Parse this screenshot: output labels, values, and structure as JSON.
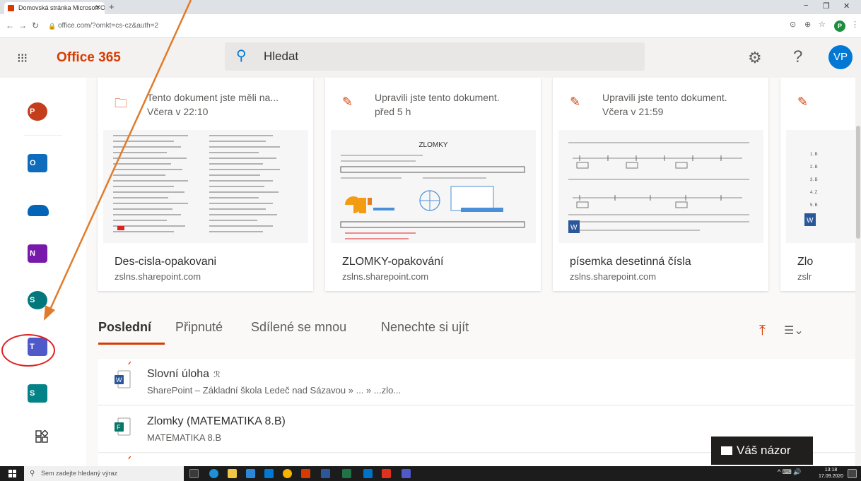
{
  "browser": {
    "tab_title": "Domovská stránka Microsoft Offi",
    "url": "office.com/?omkt=cs-cz&auth=2",
    "profile_initial": "P"
  },
  "header": {
    "brand": "Office 365",
    "search_placeholder": "Hledat",
    "avatar_initials": "VP",
    "help_label": "?"
  },
  "colors": {
    "brand": "#d83b01",
    "accent": "#0078d4",
    "annotation": "#e07b2a",
    "annotation_circle": "#e02020"
  },
  "rail": {
    "apps": [
      {
        "name": "PowerPoint",
        "letter": "P",
        "color": "#c43e1c"
      },
      {
        "name": "Outlook",
        "letter": "O",
        "color": "#0f6cbd"
      },
      {
        "name": "OneDrive",
        "letter": "",
        "color": "#0364b8"
      },
      {
        "name": "OneNote",
        "letter": "N",
        "color": "#7719aa"
      },
      {
        "name": "SharePoint",
        "letter": "S",
        "color": "#03787c"
      },
      {
        "name": "Teams",
        "letter": "T",
        "color": "#5059c9"
      },
      {
        "name": "Sway",
        "letter": "S",
        "color": "#038387"
      }
    ]
  },
  "cards": [
    {
      "action1": "Tento dokument jste měli na...",
      "action2": "Včera v 22:10",
      "name": "Des-cisla-opakovani",
      "site": "zslns.sharepoint.com",
      "icon": "folder-icon"
    },
    {
      "action1": "Upravili jste tento dokument.",
      "action2": "před 5 h",
      "name": "ZLOMKY-opakování",
      "site": "zslns.sharepoint.com",
      "icon": "pencil-icon",
      "thumb_title": "ZLOMKY"
    },
    {
      "action1": "Upravili jste tento dokument.",
      "action2": "Včera v 21:59",
      "name": "písemka desetinná čísla",
      "site": "zslns.sharepoint.com",
      "icon": "pencil-icon"
    },
    {
      "action1": "",
      "action2": "",
      "name": "Zlo",
      "site": "zslr",
      "icon": "pencil-icon"
    }
  ],
  "tabs": [
    "Poslední",
    "Připnuté",
    "Sdílené se mnou",
    "Nenechte si ujít"
  ],
  "files": [
    {
      "name": "Slovní úloha",
      "path": "SharePoint – Základní škola Ledeč nad Sázavou » ... » ...zlo...",
      "icon": "word-icon",
      "shared": "ℛ"
    },
    {
      "name": "Zlomky (MATEMATIKA 8.B)",
      "path": "MATEMATIKA 8.B",
      "icon": "forms-icon",
      "shared": ""
    }
  ],
  "feedback_label": "Váš názor",
  "taskbar": {
    "search_placeholder": "Sem zadejte hledaný výraz",
    "time": "13:18",
    "date": "17.09.2020"
  }
}
